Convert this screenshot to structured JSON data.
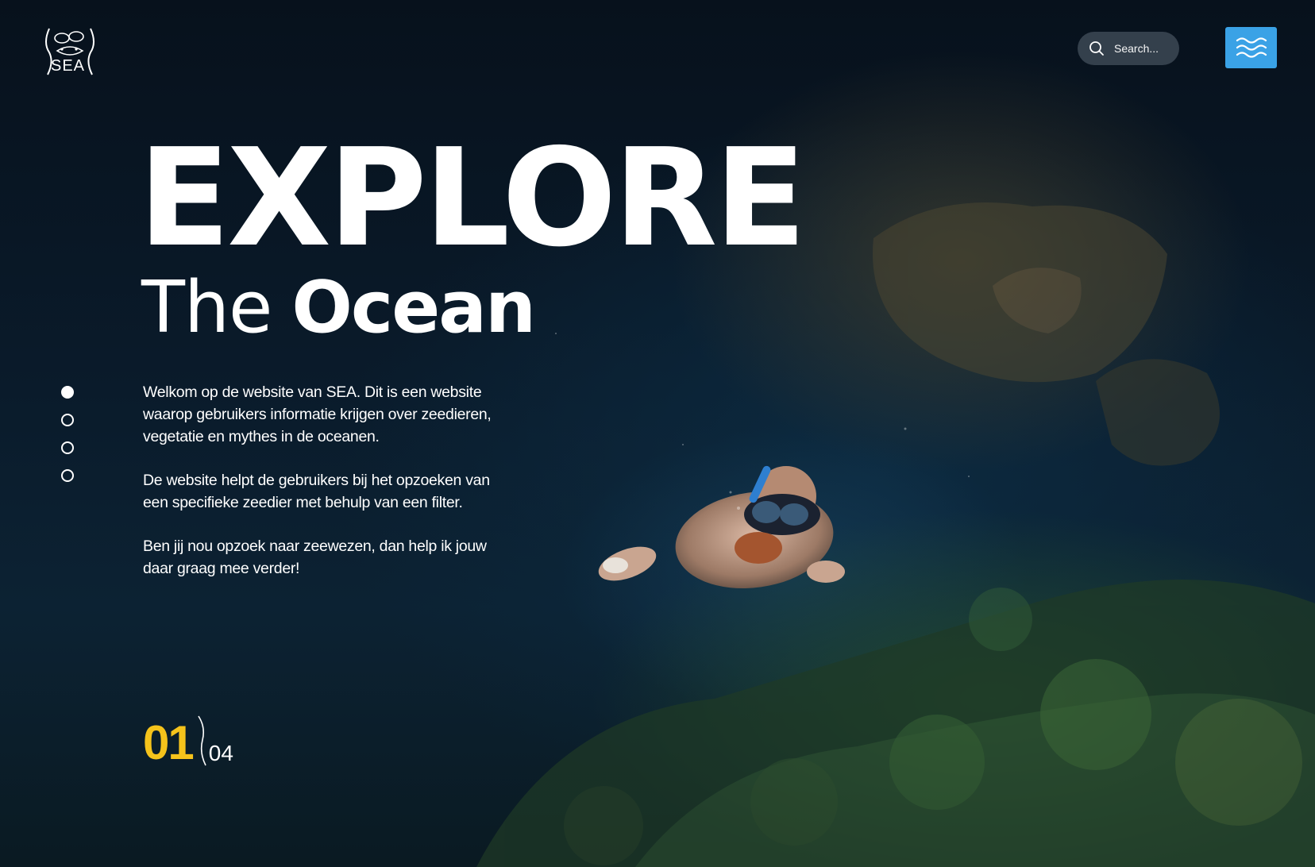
{
  "brand": {
    "logo_text": "SEA"
  },
  "header": {
    "search": {
      "placeholder": "Search...",
      "icon": "search-icon"
    },
    "menu": {
      "icon": "waves-menu-icon",
      "color": "#3aa2e6"
    }
  },
  "hero": {
    "title": "EXPLORE",
    "subtitle_light": "The",
    "subtitle_bold": "Ocean"
  },
  "intro": {
    "paragraphs": [
      "Welkom op de website van SEA. Dit is een website waarop gebruikers informatie krijgen over zeedieren, vegetatie en mythes in de oceanen.",
      "De website helpt de gebruikers bij het opzoeken van een specifieke zeedier met behulp van een filter.",
      "Ben jij nou opzoek naar zeewezen, dan help ik jouw daar graag mee verder!"
    ]
  },
  "slider": {
    "dot_count": 4,
    "active_index": 0,
    "current": "01",
    "total": "04",
    "accent_color": "#f5c31b"
  },
  "background": {
    "scene": "snorkeler-underwater-photo"
  }
}
